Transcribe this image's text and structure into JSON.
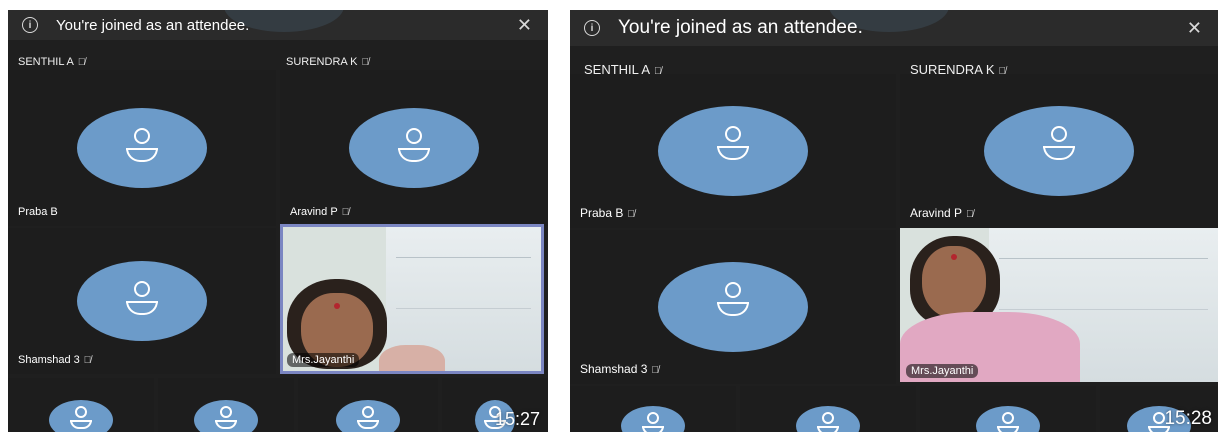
{
  "left": {
    "banner": {
      "message": "You're joined as an attendee."
    },
    "row_labels": [
      "SENTHIL A",
      "SURENDRA K"
    ],
    "tiles": [
      {
        "name": "Praba B",
        "muted": false
      },
      {
        "name": "Aravind P",
        "muted": true
      },
      {
        "name": "Shamshad 3",
        "muted": true
      }
    ],
    "video": {
      "name": "Mrs.Jayanthi"
    },
    "clock": "15:27"
  },
  "right": {
    "banner": {
      "message": "You're joined as an attendee."
    },
    "row_labels": [
      "SENTHIL A",
      "SURENDRA K"
    ],
    "tiles": [
      {
        "name": "Praba B",
        "muted": true
      },
      {
        "name": "Aravind P",
        "muted": true
      },
      {
        "name": "Shamshad 3",
        "muted": true
      }
    ],
    "video": {
      "name": "Mrs.Jayanthi"
    },
    "clock": "15:28"
  },
  "icons": {
    "info": "info-icon",
    "close": "close-icon",
    "mute": "mic-off-icon",
    "avatar": "person-avatar-icon"
  },
  "colors": {
    "background": "#1f1f1f",
    "avatar": "#6c9bc9",
    "active_speaker_border": "#7b86c2"
  }
}
